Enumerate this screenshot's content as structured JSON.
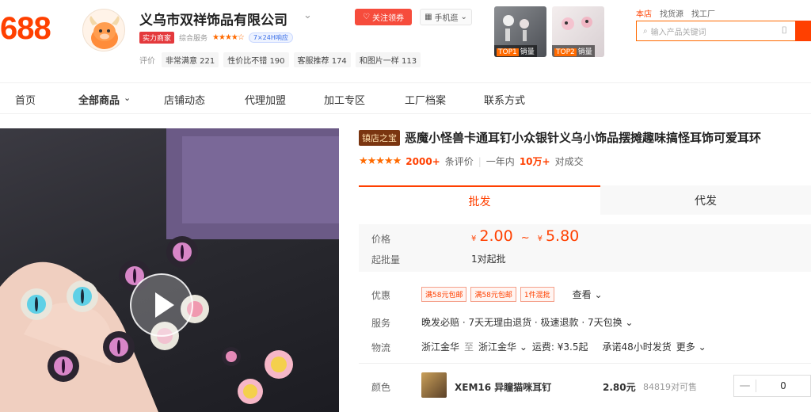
{
  "header": {
    "logo": "688",
    "shop_name": "义乌市双祥饰品有限公司",
    "badge_real": "实力商家",
    "service_label": "综合服务",
    "service_stars": "★★★★☆",
    "badge_24h": "7×24H响应",
    "review_label": "评价",
    "review_tags": [
      "非常满意 221",
      "性价比不错 190",
      "客服推荐 174",
      "和图片一样 113"
    ],
    "follow_label": "关注领券",
    "mobile_label": "手机逛",
    "top_products": [
      {
        "rank": "TOP1",
        "tag": "销量"
      },
      {
        "rank": "TOP2",
        "tag": "销量"
      }
    ],
    "search_tabs": [
      "本店",
      "找货源",
      "找工厂"
    ],
    "search_placeholder": "输入产品关键词"
  },
  "nav": {
    "items": [
      "首页",
      "全部商品",
      "店铺动态",
      "代理加盟",
      "加工专区",
      "工厂档案",
      "联系方式"
    ]
  },
  "product": {
    "badge": "镇店之宝",
    "title": "恶魔小怪兽卡通耳钉小众银针义乌小饰品摆摊趣味搞怪耳饰可爱耳环",
    "stars": "★★★★★",
    "review_count": "2000+",
    "review_unit": "条评价",
    "sales_period": "一年内",
    "sales_count": "10万+",
    "sales_unit": "对成交",
    "tabs": [
      "批发",
      "代发"
    ],
    "price_label": "价格",
    "price_currency": "¥",
    "price_min": "2.00",
    "price_sep": "~",
    "price_max": "5.80",
    "min_order_label": "起批量",
    "min_order": "1对起批",
    "discount_label": "优惠",
    "coupons": [
      "满58元包邮",
      "满58元包邮",
      "1件混批"
    ],
    "view_more": "查看",
    "service_label": "服务",
    "service_text": "晚发必赔 · 7天无理由退货 · 极速退款 · 7天包换",
    "logistics_label": "物流",
    "from": "浙江金华",
    "to_word": "至",
    "to": "浙江金华",
    "freight": "运费: ¥3.5起",
    "ship_promise": "承诺48小时发货",
    "more": "更多",
    "color_label": "颜色",
    "sku_name": "XEM16 异瞳猫咪耳钉",
    "sku_price": "2.80元",
    "sku_stock": "84819对可售",
    "qty": "0",
    "minus": "—"
  },
  "colors": {
    "brand": "#ff4000",
    "accent": "#ff6a00"
  }
}
